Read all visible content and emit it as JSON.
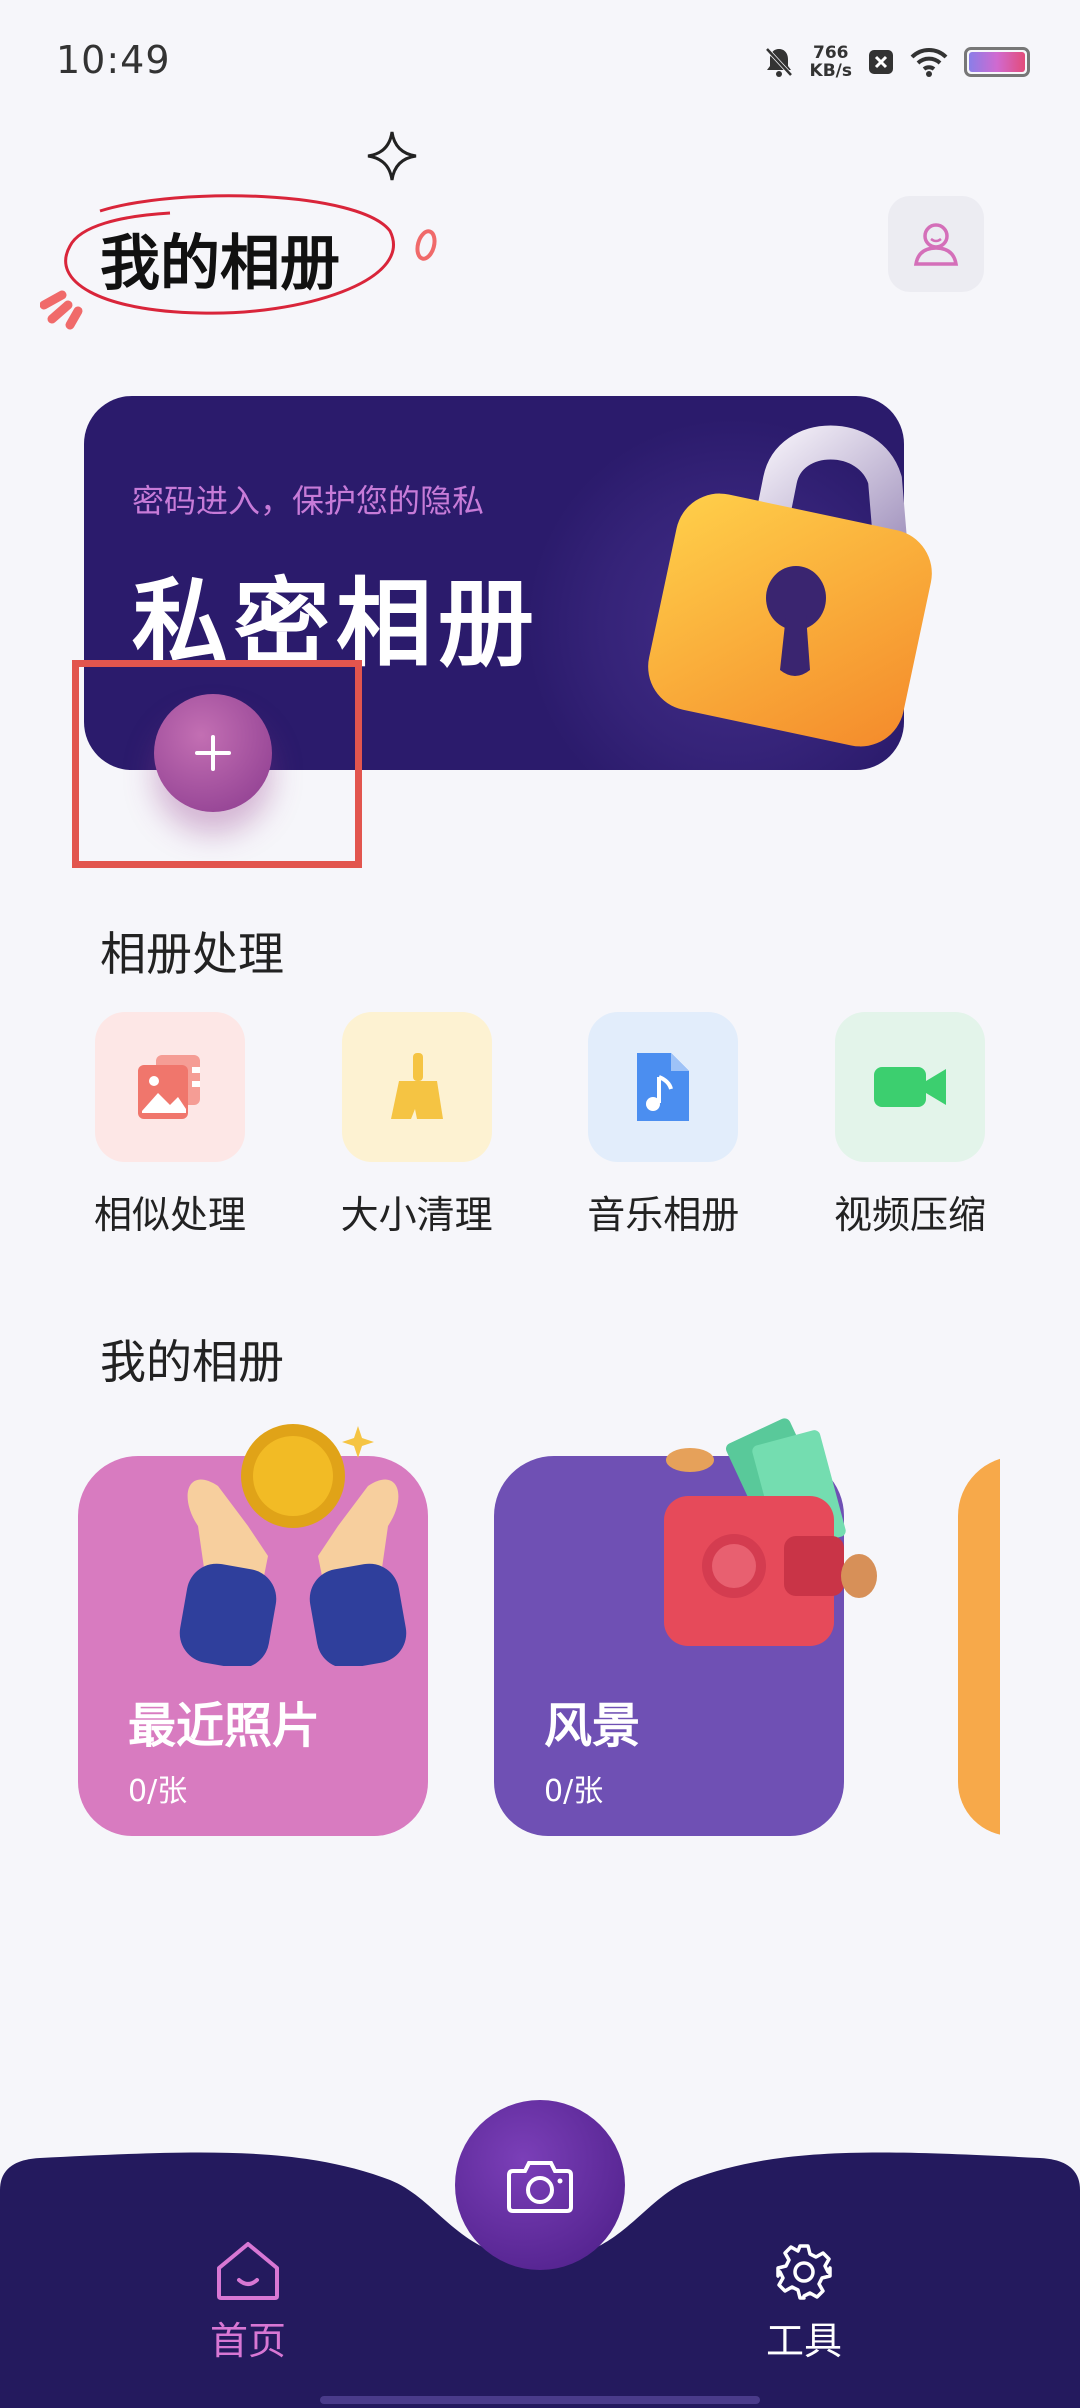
{
  "status_bar": {
    "time": "10:49",
    "net_speed_value": "766",
    "net_speed_unit": "KB/s",
    "icons": [
      "bell-off-icon",
      "close-box-icon",
      "wifi-icon",
      "battery-icon"
    ]
  },
  "header": {
    "title": "我的相册",
    "avatar_icon": "user-icon"
  },
  "private_album": {
    "subtitle": "密码进入，保护您的隐私",
    "title": "私密相册",
    "add_icon": "plus-icon",
    "lock_icon": "padlock-icon"
  },
  "tools_section": {
    "title": "相册处理",
    "items": [
      {
        "label": "相似处理",
        "icon": "photo-stack-icon",
        "bg": "#fde7e6",
        "color": "#f0766c"
      },
      {
        "label": "大小清理",
        "icon": "broom-icon",
        "bg": "#fdf2d2",
        "color": "#f5c443"
      },
      {
        "label": "音乐相册",
        "icon": "music-file-icon",
        "bg": "#e2edfb",
        "color": "#4b8ef0"
      },
      {
        "label": "视频压缩",
        "icon": "video-camera-icon",
        "bg": "#e3f4ea",
        "color": "#3ccf6f"
      }
    ]
  },
  "albums_section": {
    "title": "我的相册",
    "albums": [
      {
        "name": "最近照片",
        "count": "0/张",
        "color": "#d87bc0",
        "art": "hands-coin-icon"
      },
      {
        "name": "风景",
        "count": "0/张",
        "color": "#6f50b4",
        "art": "wallet-money-icon"
      },
      {
        "name": "",
        "count": "",
        "color": "#f7a94a",
        "art": ""
      }
    ]
  },
  "bottom_nav": {
    "home_label": "首页",
    "tools_label": "工具",
    "camera_icon": "camera-icon",
    "bar_color": "#241a5e",
    "active_color": "#d877d4"
  }
}
